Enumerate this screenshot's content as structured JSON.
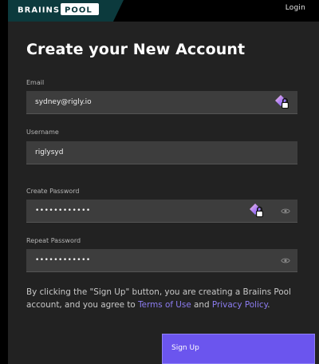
{
  "header": {
    "logo_text": "BRAIINS POOL",
    "login_label": "Login"
  },
  "form": {
    "title": "Create your New Account",
    "email": {
      "label": "Email",
      "value": "sydney@rigly.io",
      "icon": "password-manager-key-icon"
    },
    "username": {
      "label": "Username",
      "value": "riglysyd"
    },
    "create_password": {
      "label": "Create Password",
      "value": "••••••••••••",
      "icons": [
        "password-manager-key-icon",
        "eye-icon"
      ]
    },
    "repeat_password": {
      "label": "Repeat Password",
      "value": "••••••••••••",
      "icons": [
        "eye-icon"
      ]
    },
    "agreement": {
      "prefix": "By clicking the \"Sign Up\" button, you are creating a Braiins Pool account, and you agree to",
      "terms_link": "Terms of Use",
      "and": "and",
      "privacy_link": "Privacy Policy",
      "suffix": "."
    },
    "submit_label": "Sign Up"
  },
  "colors": {
    "background": "#000000",
    "panel": "#222222",
    "field": "#3d3d3d",
    "brand_teal": "#0c3a3d",
    "accent_purple": "#6b55ee",
    "link_purple": "#8c7cf0"
  }
}
